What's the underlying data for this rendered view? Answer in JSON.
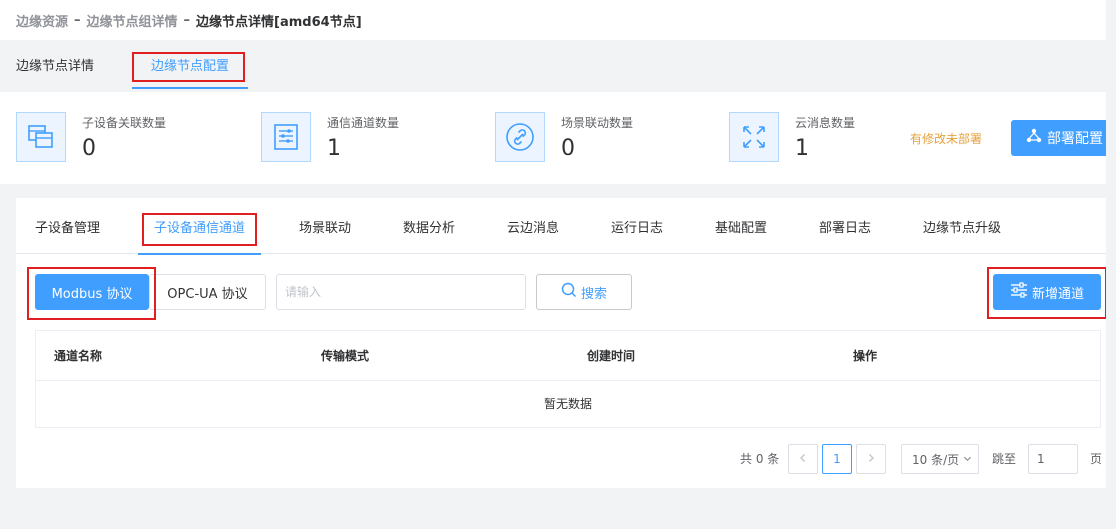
{
  "breadcrumb": {
    "items": [
      "边缘资源",
      "边缘节点组详情",
      "边缘节点详情[amd64节点]"
    ],
    "separator": "–"
  },
  "top_tabs": [
    {
      "label": "边缘节点详情",
      "active": false
    },
    {
      "label": "边缘节点配置",
      "active": true
    }
  ],
  "stats": [
    {
      "label": "子设备关联数量",
      "value": "0",
      "icon": "devices-icon"
    },
    {
      "label": "通信通道数量",
      "value": "1",
      "icon": "channel-list-icon"
    },
    {
      "label": "场景联动数量",
      "value": "0",
      "icon": "link-icon"
    },
    {
      "label": "云消息数量",
      "value": "1",
      "icon": "arrows-icon"
    }
  ],
  "pending_text": "有修改未部署",
  "deploy_label": "部署配置",
  "sub_tabs": [
    {
      "label": "子设备管理"
    },
    {
      "label": "子设备通信通道",
      "active": true
    },
    {
      "label": "场景联动"
    },
    {
      "label": "数据分析"
    },
    {
      "label": "云边消息"
    },
    {
      "label": "运行日志"
    },
    {
      "label": "基础配置"
    },
    {
      "label": "部署日志"
    },
    {
      "label": "边缘节点升级"
    }
  ],
  "toolbar": {
    "modbus_label": "Modbus 协议",
    "opcua_label": "OPC-UA 协议",
    "search_placeholder": "请输入",
    "search_label": "搜索",
    "add_label": "新增通道"
  },
  "table": {
    "columns": [
      "通道名称",
      "传输模式",
      "创建时间",
      "操作"
    ],
    "rows": [],
    "empty_text": "暂无数据"
  },
  "pagination": {
    "total_text": "共 0 条",
    "current_page": "1",
    "page_size": "10 条/页",
    "jump_label": "跳至",
    "jump_value": "1",
    "unit": "页"
  },
  "colors": {
    "primary": "#409eff",
    "highlight_box": "#e02020",
    "warning": "#e6a23c"
  }
}
